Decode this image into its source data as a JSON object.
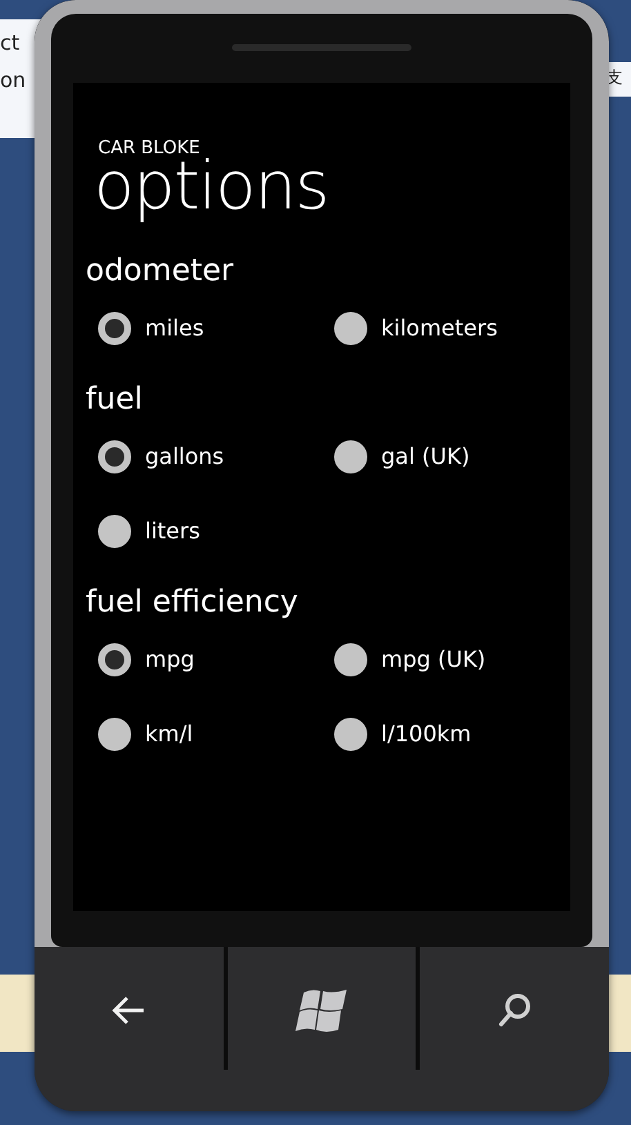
{
  "desktop": {
    "left_texts": [
      "ct",
      "on"
    ],
    "right_text": "支"
  },
  "app": {
    "title": "CAR BLOKE",
    "page_title": "options"
  },
  "sections": [
    {
      "title": "odometer",
      "options": [
        {
          "label": "miles",
          "selected": true
        },
        {
          "label": "kilometers",
          "selected": false
        }
      ]
    },
    {
      "title": "fuel",
      "options": [
        {
          "label": "gallons",
          "selected": true
        },
        {
          "label": "gal (UK)",
          "selected": false
        },
        {
          "label": "liters",
          "selected": false
        }
      ]
    },
    {
      "title": "fuel efficiency",
      "options": [
        {
          "label": "mpg",
          "selected": true
        },
        {
          "label": "mpg (UK)",
          "selected": false
        },
        {
          "label": "km/l",
          "selected": false
        },
        {
          "label": "l/100km",
          "selected": false
        }
      ]
    }
  ],
  "hardware_buttons": [
    {
      "kind": "back"
    },
    {
      "kind": "start"
    },
    {
      "kind": "search"
    }
  ]
}
